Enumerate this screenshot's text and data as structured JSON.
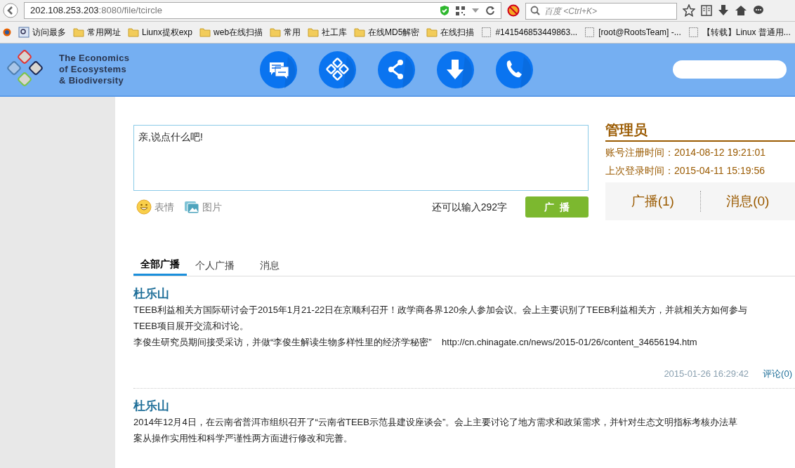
{
  "browser": {
    "url_host": "202.108.253.203",
    "url_path": ":8080/file/tcircle",
    "search_placeholder": "百度 <Ctrl+K>",
    "bookmarks": [
      {
        "kind": "special",
        "label": "访问最多"
      },
      {
        "kind": "folder",
        "label": "常用网址"
      },
      {
        "kind": "folder",
        "label": "Liunx提权exp"
      },
      {
        "kind": "folder",
        "label": "web在线扫描"
      },
      {
        "kind": "folder",
        "label": "常用"
      },
      {
        "kind": "folder",
        "label": "社工库"
      },
      {
        "kind": "folder",
        "label": "在线MD5解密"
      },
      {
        "kind": "folder",
        "label": "在线扫描"
      },
      {
        "kind": "page",
        "label": "#141546853449863..."
      },
      {
        "kind": "page",
        "label": "[root@RootsTeam] -..."
      },
      {
        "kind": "page",
        "label": "【转载】Linux 普通用..."
      }
    ]
  },
  "header": {
    "logo_lines": [
      "The Economics",
      "of Ecosystems",
      "& Biodiversity"
    ],
    "nav": [
      {
        "kind": "chat"
      },
      {
        "kind": "grid"
      },
      {
        "kind": "share"
      },
      {
        "kind": "download"
      },
      {
        "kind": "phone"
      }
    ]
  },
  "composer": {
    "value": "亲,说点什么吧!",
    "tools": [
      {
        "kind": "emoji",
        "label": "表情"
      },
      {
        "kind": "image",
        "label": "图片"
      }
    ],
    "counter": "还可以输入292字",
    "submit": "广  播"
  },
  "profile": {
    "name": "管理员",
    "lines": [
      "账号注册时间：2014-08-12 19:21:01",
      "上次登录时间：2015-04-11 15:19:56"
    ],
    "stats": [
      "广播(1)",
      "消息(0)"
    ]
  },
  "tabs": [
    {
      "label": "全部广播",
      "selected": true
    },
    {
      "label": "个人广播",
      "selected": false
    },
    {
      "label": "消息",
      "selected": false
    }
  ],
  "posts": [
    {
      "author": "杜乐山",
      "lines": [
        "TEEB利益相关方国际研讨会于2015年1月21-22日在京顺利召开！政学商各界120余人参加会议。会上主要识别了TEEB利益相关方，并就相关方如何参与",
        "TEEB项目展开交流和讨论。",
        "李俊生研究员期间接受采访，并做“李俊生解读生物多样性里的经济学秘密”    http://cn.chinagate.cn/news/2015-01/26/content_34656194.htm"
      ],
      "time": "2015-01-26 16:29:42",
      "comments": "评论(0)"
    },
    {
      "author": "杜乐山",
      "lines": [
        "2014年12月4日，在云南省普洱市组织召开了“云南省TEEB示范县建设座谈会”。会上主要讨论了地方需求和政策需求，并针对生态文明指标考核办法草",
        "案从操作实用性和科学严谨性两方面进行修改和完善。"
      ]
    }
  ]
}
